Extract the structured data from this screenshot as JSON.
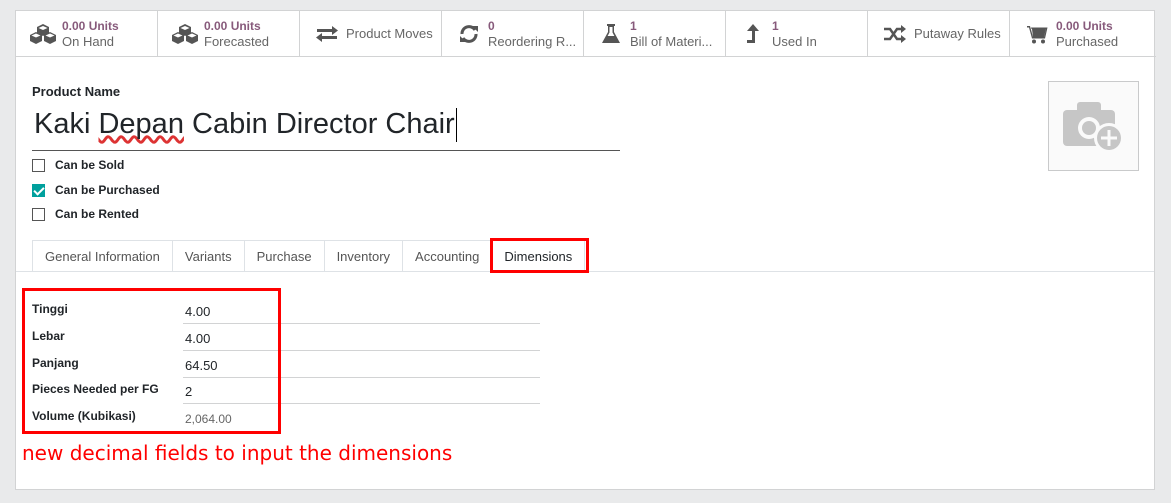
{
  "smart_buttons": [
    {
      "id": "on-hand",
      "icon": "cubes-icon",
      "value": "0.00 Units",
      "label": "On Hand"
    },
    {
      "id": "forecasted",
      "icon": "cubes-icon",
      "value": "0.00 Units",
      "label": "Forecasted"
    },
    {
      "id": "product-moves",
      "icon": "exchange-icon",
      "label": "Product Moves"
    },
    {
      "id": "reordering-rules",
      "icon": "refresh-icon",
      "value": "0",
      "label": "Reordering R..."
    },
    {
      "id": "bill-of-materials",
      "icon": "flask-icon",
      "value": "1",
      "label": "Bill of Materi..."
    },
    {
      "id": "used-in",
      "icon": "level-up-icon",
      "value": "1",
      "label": "Used In"
    },
    {
      "id": "putaway-rules",
      "icon": "random-icon",
      "label": "Putaway Rules"
    },
    {
      "id": "purchased",
      "icon": "cart-icon",
      "value": "0.00 Units",
      "label": "Purchased"
    }
  ],
  "product": {
    "name_label": "Product Name",
    "name_part1": "Kaki ",
    "name_part2": "Depan",
    "name_part3": " Cabin Director Chair"
  },
  "checkboxes": [
    {
      "label": "Can be Sold",
      "checked": false
    },
    {
      "label": "Can be Purchased",
      "checked": true
    },
    {
      "label": "Can be Rented",
      "checked": false
    }
  ],
  "tabs": [
    "General Information",
    "Variants",
    "Purchase",
    "Inventory",
    "Accounting",
    "Dimensions"
  ],
  "active_tab": "Dimensions",
  "dimension_fields": [
    {
      "label": "Tinggi",
      "value": "4.00"
    },
    {
      "label": "Lebar",
      "value": "4.00"
    },
    {
      "label": "Panjang",
      "value": "64.50"
    },
    {
      "label": "Pieces Needed per FG",
      "value": "2"
    },
    {
      "label": "Volume (Kubikasi)",
      "value": "2,064.00"
    }
  ],
  "annotation": "new decimal fields to input the dimensions",
  "colors": {
    "accent": "#875a7b",
    "check": "#00a09d",
    "highlight": "#ff0000"
  }
}
